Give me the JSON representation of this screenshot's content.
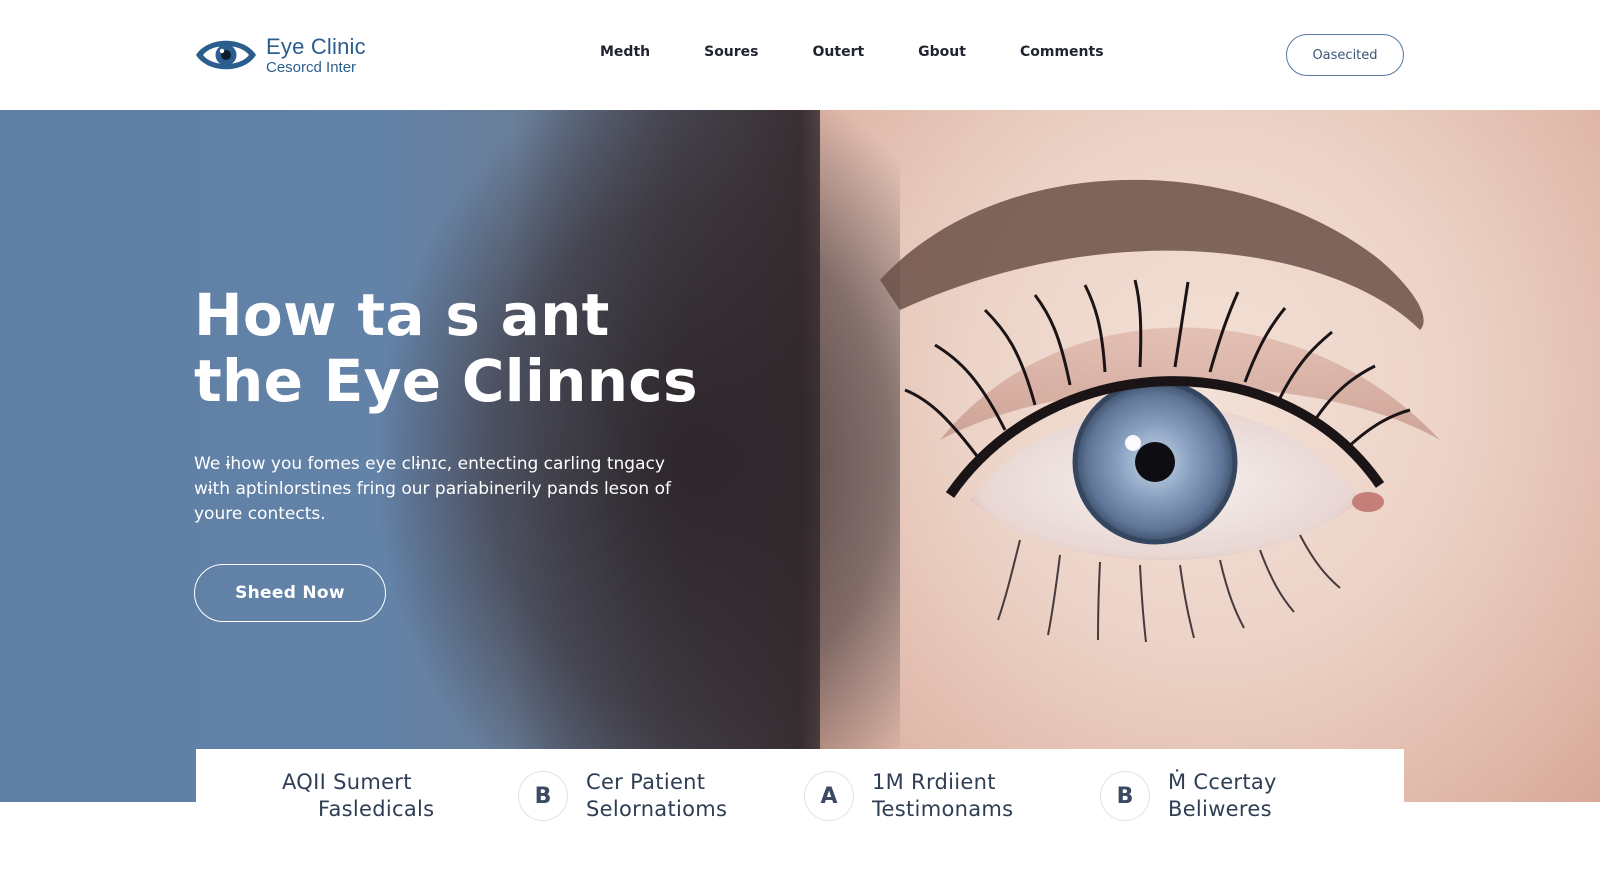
{
  "brand": {
    "name": "Eye Clinic",
    "subtitle": "Cesorcd Inter",
    "icon": "eye-logo-icon",
    "color": "#2b5e8f"
  },
  "nav": {
    "items": [
      "Medth",
      "Soures",
      "Outert",
      "Gbout",
      "Comments"
    ],
    "cta_label": "Oasecited"
  },
  "hero": {
    "title_line1": "How ta s ant",
    "title_line2": "the Eye Clinncs",
    "description": "We ɨhow you fomes eye clɨnɪc, entecting carling tngacy wɨth aptinlorstines fring our pariabinerily pands leson of youre contects.",
    "button_label": "Sheed Now",
    "image": "close-up-blue-eye-photo"
  },
  "features": [
    {
      "badge": "",
      "line1": "AQII Sumert",
      "line2": "Fasledicals"
    },
    {
      "badge": "B",
      "line1": "Cer Patient",
      "line2": "Selornatioms"
    },
    {
      "badge": "A",
      "line1": "1M Rrdiient",
      "line2": "Testimonams"
    },
    {
      "badge": "B",
      "line1": "Ṁ Ccertay",
      "line2": "Beliweres"
    }
  ],
  "colors": {
    "accent": "#2b5e8f",
    "hero_blue": "#6382a8",
    "text_dark": "#1f2430"
  }
}
